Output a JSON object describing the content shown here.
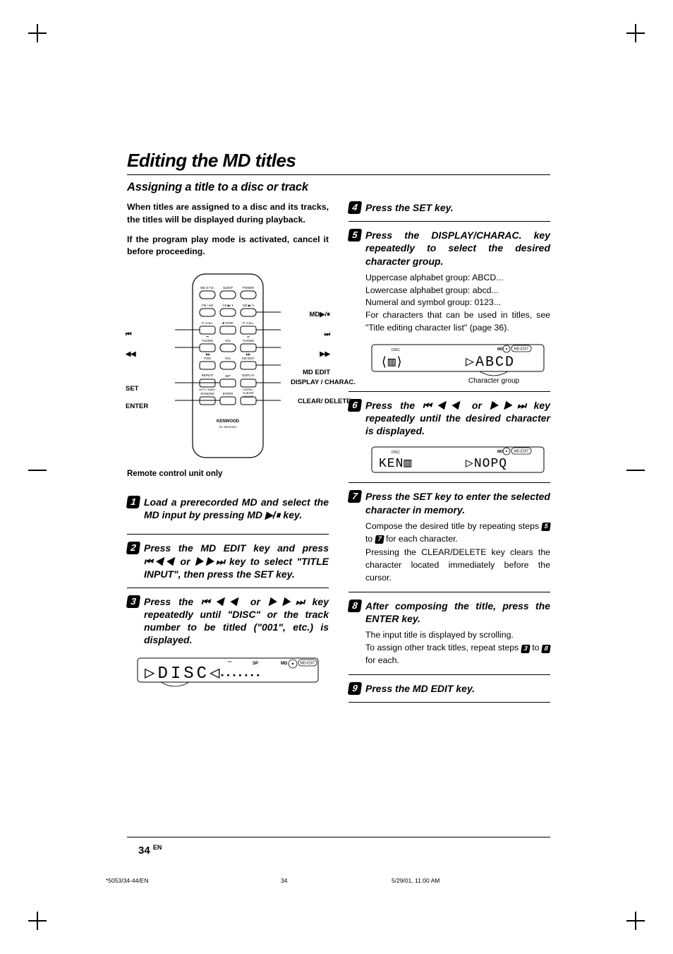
{
  "title": "Editing the MD titles",
  "subtitle": "Assigning a title to a disc or track",
  "intro_1": "When titles are assigned to a disc and its tracks, the titles will be displayed during playback.",
  "intro_2": "If the program play mode is activated, cancel it before proceeding.",
  "remote_caption": "Remote control unit only",
  "remote_labels": {
    "prev_track": "⏮",
    "rew": "◀◀",
    "set": "SET",
    "enter": "ENTER",
    "md_play": "MD▶/⏸",
    "next_track": "⏭",
    "ff": "▶▶",
    "md_edit": "MD EDIT",
    "display_charac": "DISPLAY / CHARAC.",
    "clear_delete": "CLEAR/ DELETE",
    "brand": "KENWOOD",
    "model": "RC-MDX0002"
  },
  "remote_btn_text": {
    "mdote": "MD O.T.E.",
    "sleep": "SLEEP",
    "power": "POWER",
    "fmam": "FM / AM",
    "cd": "CD ▶/ ⏸",
    "md": "MD ▶/ ⏸",
    "pcall_l": "P. CALL",
    "pcall_r": "P. CALL",
    "stop": "■ STOP",
    "tuning_l": "TUNING",
    "vol_dn": "VOL",
    "tuning_r": "TUNING",
    "pgm": "PGM",
    "vol_up": "VOL",
    "mdedit": "MD EDIT",
    "repeat": "REPEAT",
    "repeat2": "AUTO / MANU.",
    "set": "SET",
    "display": "DISPLAY",
    "display2": "CHARAC.",
    "random": "RANDOM",
    "enter_b": "ENTER",
    "clear": "CLEAR/",
    "clear2": "DELETE"
  },
  "steps_left": {
    "s1": "Load a prerecorded MD and select the MD input by pressing MD ▶/⏸ key.",
    "s2": "Press the MD EDIT key and press ⏮◀◀ or ▶▶⏭ key to select \"TITLE INPUT\", then press the SET key.",
    "s3": "Press the ⏮◀◀ or ▶▶⏭ key repeatedly until \"DISC\" or the track number to be titled (\"001\", etc.) is displayed."
  },
  "disp1": {
    "text": "DISC",
    "sp": "SP",
    "md": "MD",
    "badge": "MD-EDIT"
  },
  "steps_right": {
    "s4": "Press the SET key.",
    "s5": "Press the DISPLAY/CHARAC. key repeatedly to select the desired character group.",
    "s5_body_1": "Uppercase alphabet group: ABCD...",
    "s5_body_2": "Lowercase alphabet group: abcd...",
    "s5_body_3": "Numeral and symbol group: 0123...",
    "s5_body_4": "For characters that can be used in titles, see \"Title editing character list\" (page 36).",
    "s5_fig_caption": "Character group",
    "s5_fig_left": "",
    "s5_fig_right": "ABCD",
    "s5_disc": "DISC",
    "s5_md": "MD",
    "s5_badge": "MD-EDIT",
    "s6": "Press the ⏮◀◀ or ▶▶⏭ key repeatedly until the desired character is displayed.",
    "s6_fig_left": "KEN",
    "s6_fig_right": "NOPQ",
    "s6_disc": "DISC",
    "s6_md": "MD",
    "s6_badge": "MD-EDIT",
    "s7": "Press the SET key to enter the selected character in memory.",
    "s7_body_1a": "Compose the desired title by repeating steps ",
    "s7_body_1b": " to ",
    "s7_body_1c": " for each character.",
    "s7_body_2": "Pressing the CLEAR/DELETE key clears the character located immediately before the cursor.",
    "s8": "After composing the title, press the ENTER key.",
    "s8_body_1": "The input title is displayed by scrolling.",
    "s8_body_2a": "To assign other track titles, repeat steps ",
    "s8_body_2b": " to ",
    "s8_body_2c": " for each.",
    "s9": "Press the MD EDIT key."
  },
  "ref_nums": {
    "r5": "5",
    "r7": "7",
    "r3": "3",
    "r8": "8"
  },
  "page_number": "34",
  "page_suffix": "EN",
  "footer_left": "*5053/34-44/EN",
  "footer_mid": "34",
  "footer_right": "5/29/01, 11:00 AM"
}
